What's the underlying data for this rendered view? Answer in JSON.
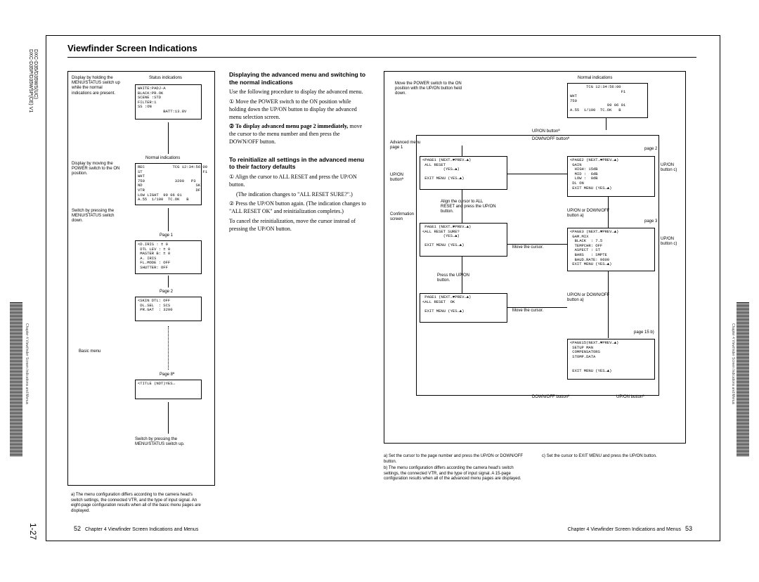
{
  "sidebar": {
    "model_lines": "DXC-D35/D35WS(UC)\nDXC-D35P/D35WSP(CE) V1",
    "page_num": "1-27",
    "chapter": "Chapter 4  Viewfinder Screen Indications and Menus"
  },
  "header": {
    "title": "Viewfinder Screen Indications"
  },
  "left_diagram": {
    "label1": "Display by holding the MENU/STATUS switch up while the normal indications are present.",
    "status_label": "Status indications",
    "screen_status": "WHITE:PADJ-A\nBLACK:PR.OK\nSCENE :STD\nFILTER:1\nSS :ON\n           BATT:13.8V",
    "label2": "Display by moving the POWER switch to the ON position.",
    "normal_label": "Normal indications",
    "screen_normal": "REC            TCG 12:34:56:00\nST                          F1\nWHT\n750             3200   P3\nND                       SK\nVTR                      DF\nLOW LIGHT  99 06 01\nA.55  1/100  TC.OK   B",
    "label3": "Switch by pressing the MENU/STATUS switch down.",
    "page1": "Page 1",
    "screen_p1": "<D.IRIS : ± 0\n DTL LEV : ± 0\n MASTER B: ± 0\n A. IRIS\n FL.MODE : OFF\n SHUTTER: OFF",
    "page2": "Page 2",
    "screen_p2": "<SKIN DTL: OFF\n DL.SEL  : SCS\n PR.GAT  : 3200",
    "basic_label": "Basic menu",
    "page8": "Page 8ª",
    "screen_p8": "<TITLE (NDT)YES→",
    "label4": "Switch by pressing the MENU/STATUS switch up.",
    "footnote": "a) The menu configuration differs according to the camera head's switch settings, the connected VTR, and the type of input signal. An eight-page configuration results when all of the basic menu pages are displayed."
  },
  "middle_text": {
    "h1": "Displaying the advanced menu and switching to the normal indications",
    "p1": "Use the following procedure to display the advanced menu.",
    "step1": "① Move the POWER switch to the ON position while holding down the UP/ON button to display the advanced menu selection screen.",
    "step2_lead": "② To display advanced menu page 2 immediately,",
    "step2_rest": " move the cursor to the menu number and then press the DOWN/OFF button.",
    "h2": "To reinitialize all settings in the advanced menu to their factory defaults",
    "r_step1": "① Align the cursor to ALL RESET and press the UP/ON button.",
    "r_step1_sub": "(The indication changes to \"ALL RESET SURE?\".)",
    "r_step2": "② Press the UP/ON button again. (The indication changes to \"ALL RESET OK\" and reinitialization completes.)",
    "r_cancel": "To cancel the reinitialization, move the cursor instead of pressing the UP/ON button."
  },
  "right_diagram": {
    "label_power": "Move the POWER switch to the ON position with the UP/ON button held down.",
    "normal_label": "Normal indications",
    "normal_screen": "       TCG 12:34:56:00\n                      F1\nWHT\n750\n                99 06 01\nA.55  1/100  TC.OK   B",
    "btn_upon": "UP/ON buttonª",
    "btn_downoff": "DOWN/OFF buttonª",
    "adv_label": "Advanced menu page 1",
    "page2_label": "page 2",
    "upon_btn2": "UP/ON buttonª",
    "upon_side": "UP/ON button c)",
    "screen_adv1": "<PAGE1 (NEXT→▼PREV→▲)\n ALL RESET\n         (YES→▲)\n\n EXIT MENU (YES→▲)",
    "screen_p2": "<PAGE2 (NEXT→▼PREV→▲)\n GAIN\n  HIGH: 15dB\n  MID :  6dB\n  LOW :  0dB\n DL ON\n EXIT MENU (YES→▲)",
    "conf_label": "Confirmation screen",
    "conf_inst": "Align the cursor to ALL RESET and press the UP/ON button.",
    "screen_conf": " PAGE1 (NEXT→▼PREV→▲)\n<ALL RESET SURE?\n         (YES→▲)\n\n EXIT MENU (YES→▲)",
    "page3_label": "page 3",
    "updown_off": "UP/ON or DOWN/OFF button a)",
    "upon_side2": "UP/ON button c)",
    "move_cur": "Move the cursor.",
    "screen_p3": "<PAGE3 (NEXT→▼PREV→▲)\n GAM.MIX\n  BLACK  : 7.5\n  TEMPCHR: OFF\n  ASPECT : ST\n  BARS   : SMPTE\n  BAUD.RATE: 9600\n EXIT MENU (YES→▲)",
    "press_upon": "Press the UP/ON button.",
    "screen_ok": " PAGE1 (NEXT→▼PREV→▲)\n<ALL RESET  OK\n\n EXIT MENU (YES→▲)",
    "updown_off2": "UP/ON or DOWN/OFF button a)",
    "page15_label": "page 15 b)",
    "screen_p15": "<PAGE15(NEXT→▼PREV→▲)\n SETUP MAN\n COMPENSATORS\n STOMP.DATA\n\n\n EXIT MENU (YES→▲)",
    "btn_downoff2": "DOWN/OFF buttonª",
    "btn_upon2": "UP/ON buttonª",
    "foot_a": "a) Set the cursor to the page number and press the UP/ON or DOWN/OFF button.",
    "foot_b": "b) The menu configuration differs according the camera head's switch settings, the connected VTR, and the type of input signal. A 15-page configuration results when all of the advanced menu pages are displayed.",
    "foot_c": "c) Set the cursor to EXIT MENU and press the UP/ON button."
  },
  "footer": {
    "left": "Chapter 4  Viewfinder Screen Indications and Menus",
    "left_num": "52",
    "right": "Chapter 4  Viewfinder Screen Indications and Menus",
    "right_num": "53"
  }
}
